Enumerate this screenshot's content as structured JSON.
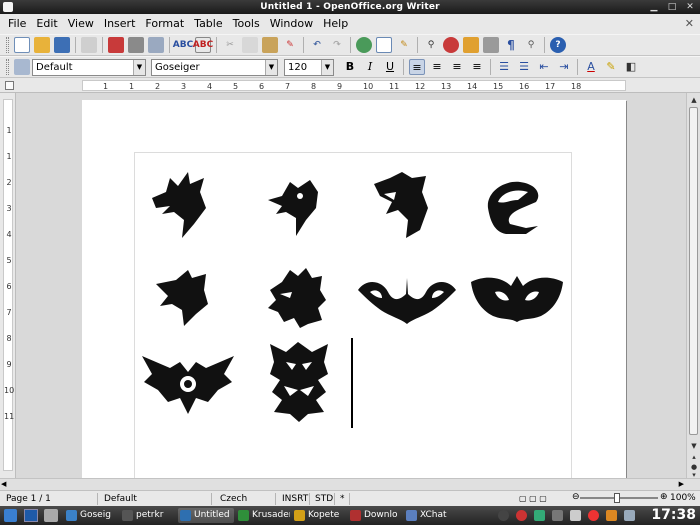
{
  "window": {
    "title": "Untitled 1 - OpenOffice.org Writer"
  },
  "menu": [
    {
      "label": "File",
      "name": "menu-file"
    },
    {
      "label": "Edit",
      "name": "menu-edit"
    },
    {
      "label": "View",
      "name": "menu-view"
    },
    {
      "label": "Insert",
      "name": "menu-insert"
    },
    {
      "label": "Format",
      "name": "menu-format"
    },
    {
      "label": "Table",
      "name": "menu-table"
    },
    {
      "label": "Tools",
      "name": "menu-tools"
    },
    {
      "label": "Window",
      "name": "menu-window"
    },
    {
      "label": "Help",
      "name": "menu-help"
    }
  ],
  "formatting": {
    "style": "Default",
    "font": "Goseiger",
    "size": "120",
    "bold": "B",
    "italic": "I",
    "underline": "U"
  },
  "ruler": {
    "h_ticks": [
      "1",
      "1",
      "2",
      "3",
      "4",
      "5",
      "6",
      "7",
      "8",
      "9",
      "10",
      "11",
      "12",
      "13",
      "14",
      "15",
      "16",
      "17",
      "18"
    ],
    "v_ticks": [
      "1",
      "1",
      "2",
      "3",
      "4",
      "5",
      "6",
      "7",
      "8",
      "9",
      "10",
      "11"
    ]
  },
  "status": {
    "page": "Page 1 / 1",
    "style": "Default",
    "language": "Czech",
    "insert_mode": "INSRT",
    "selection_mode": "STD",
    "modified": "*",
    "zoom": "100%"
  },
  "taskbar": {
    "tasks": [
      {
        "label": "Goseig",
        "color": "#3b82c8"
      },
      {
        "label": "petrkr",
        "color": "#555555"
      },
      {
        "label": "Untitled",
        "color": "#2e6fb0"
      },
      {
        "label": "Krusader",
        "color": "#2f8f3a"
      },
      {
        "label": "Kopete",
        "color": "#d4a017"
      },
      {
        "label": "Downlo",
        "color": "#b03030"
      },
      {
        "label": "XChat",
        "color": "#5b7fbf"
      }
    ],
    "clock": "17:38"
  },
  "colors": {
    "accent": "#316ac5",
    "glyph": "#111111"
  }
}
